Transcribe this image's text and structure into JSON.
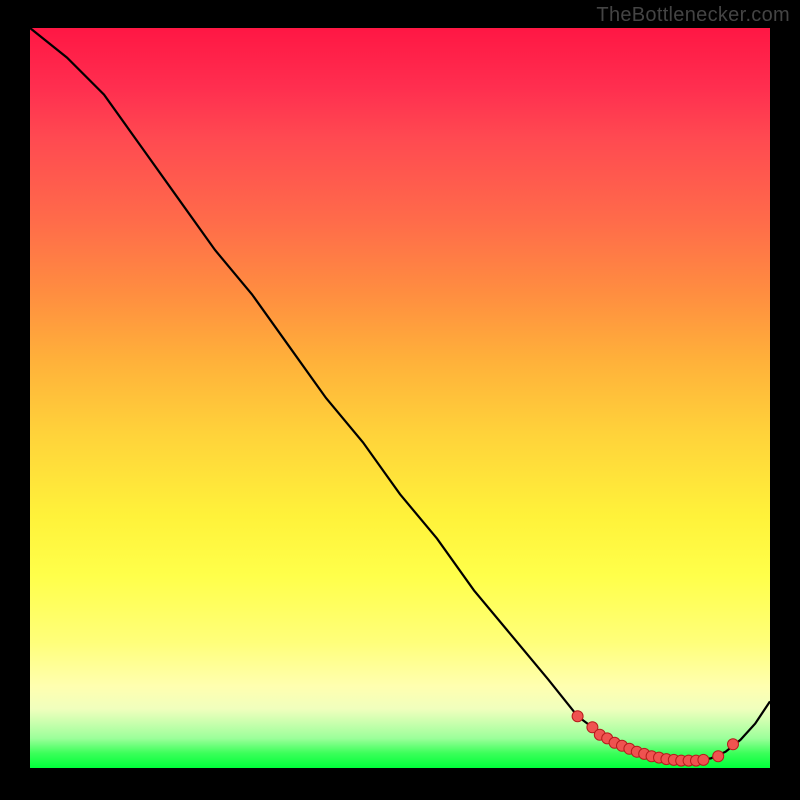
{
  "watermark": "TheBottlenecker.com",
  "colors": {
    "curve": "#000000",
    "marker_fill": "#ef5350",
    "marker_stroke": "#b71c1c"
  },
  "chart_data": {
    "type": "line",
    "title": "",
    "xlabel": "",
    "ylabel": "",
    "xlim": [
      0,
      100
    ],
    "ylim": [
      0,
      100
    ],
    "x": [
      0,
      5,
      10,
      15,
      20,
      25,
      30,
      35,
      40,
      45,
      50,
      55,
      60,
      65,
      70,
      74,
      78,
      80,
      82,
      84,
      86,
      88,
      90,
      92,
      94,
      96,
      98,
      100
    ],
    "y": [
      100,
      96,
      91,
      84,
      77,
      70,
      64,
      57,
      50,
      44,
      37,
      31,
      24,
      18,
      12,
      7,
      4,
      3,
      2.2,
      1.6,
      1.2,
      1.0,
      1.0,
      1.3,
      2.2,
      3.8,
      6.0,
      9.0
    ],
    "markers": {
      "x": [
        74,
        76,
        77,
        78,
        79,
        80,
        81,
        82,
        83,
        84,
        85,
        86,
        87,
        88,
        89,
        90,
        91,
        93,
        95
      ],
      "y": [
        7,
        5.5,
        4.5,
        4,
        3.4,
        3,
        2.6,
        2.2,
        1.9,
        1.6,
        1.4,
        1.2,
        1.1,
        1.0,
        1.0,
        1.0,
        1.1,
        1.6,
        3.2
      ]
    }
  }
}
